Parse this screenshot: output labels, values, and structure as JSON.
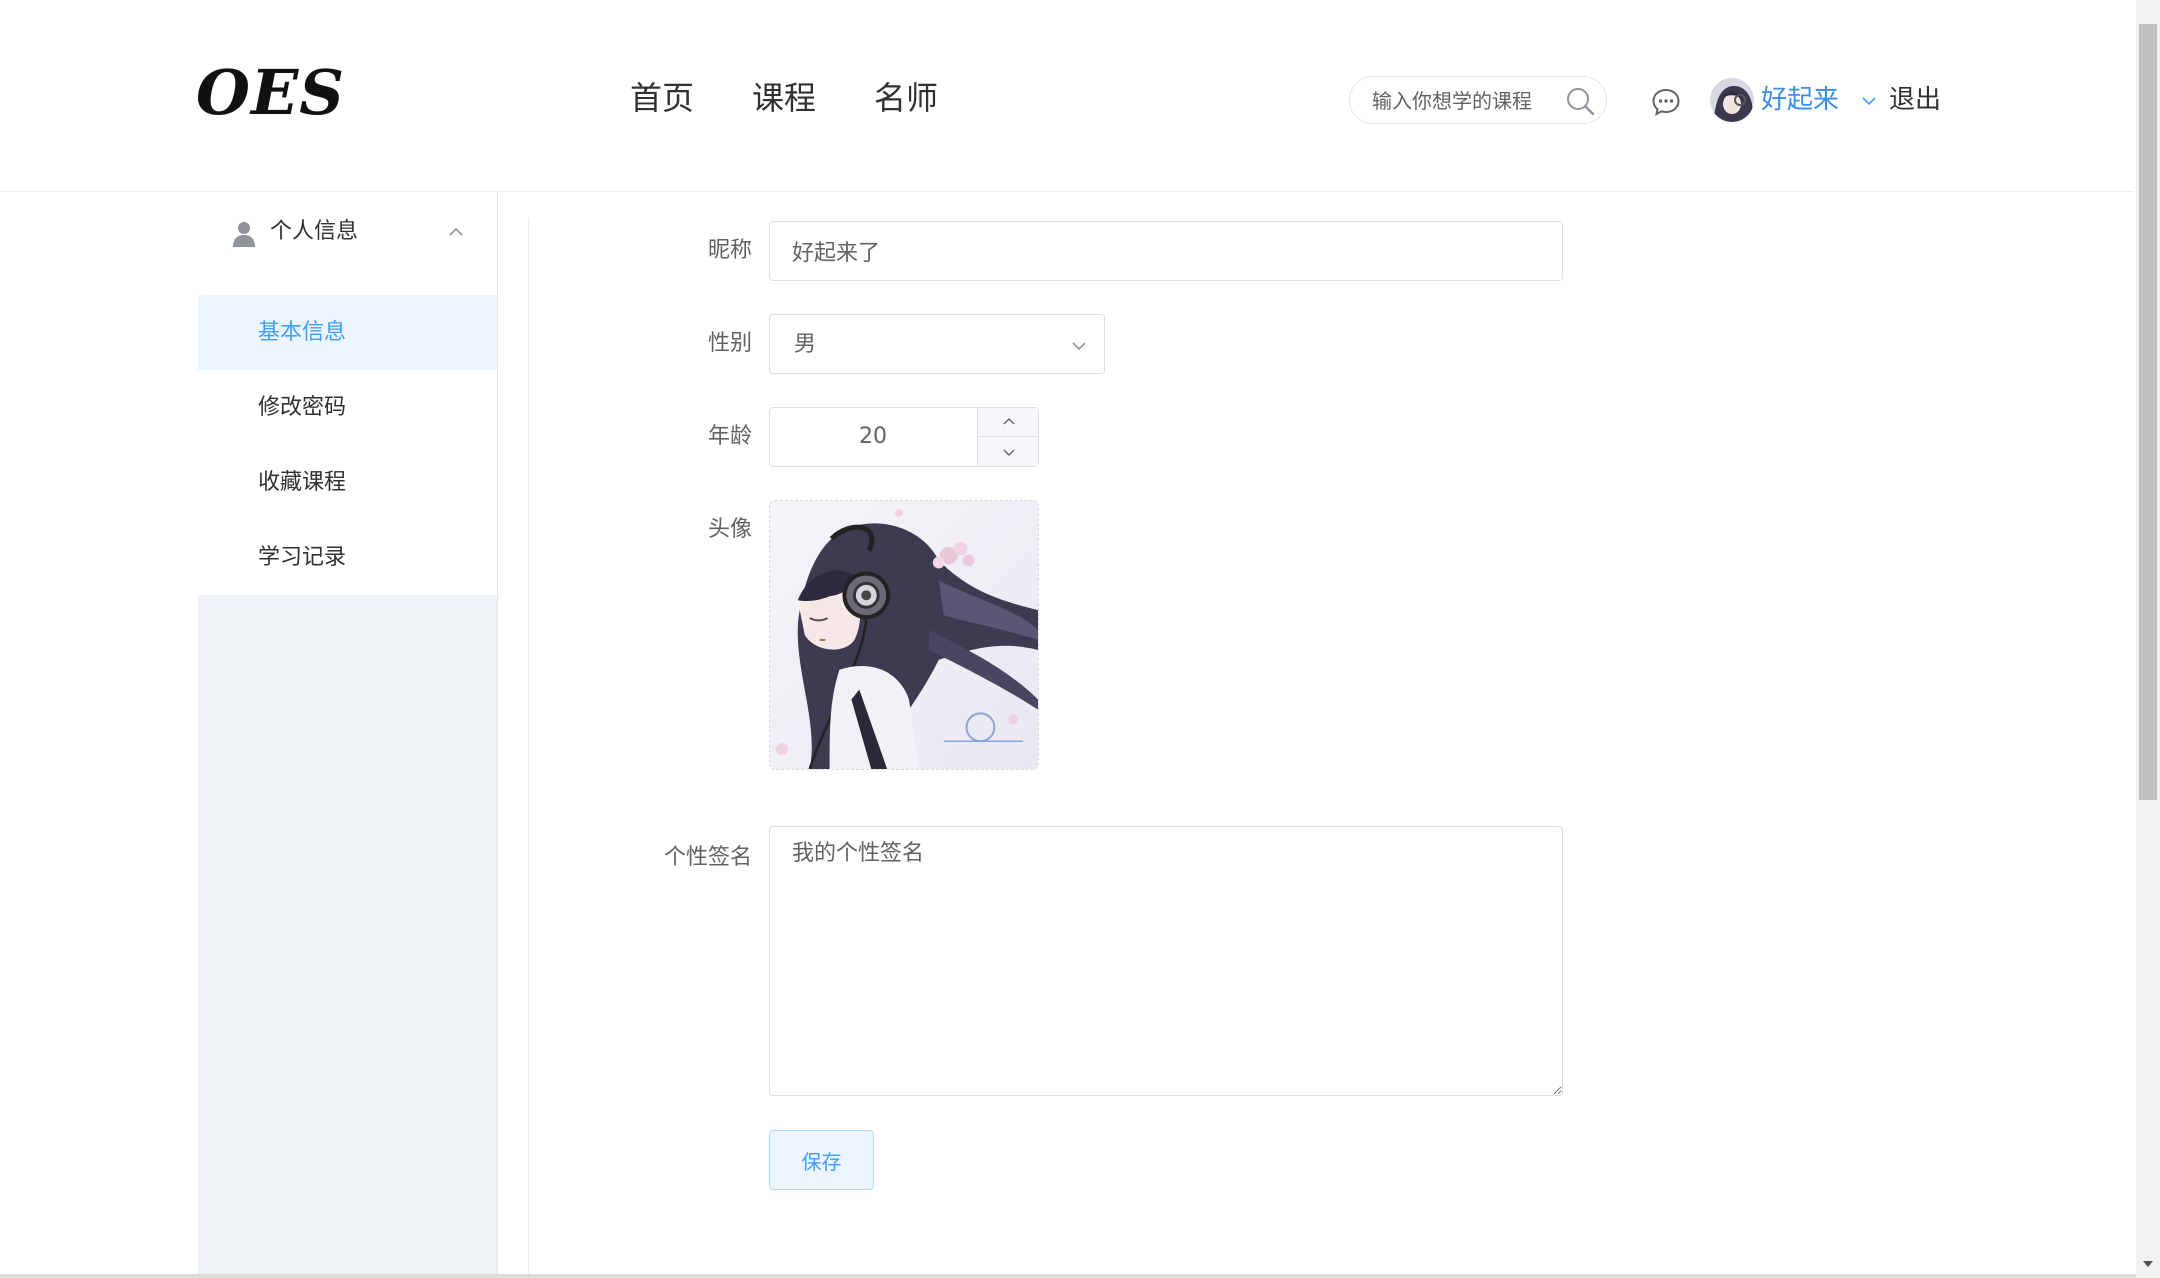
{
  "header": {
    "logo": "OES",
    "nav": [
      "首页",
      "课程",
      "名师"
    ],
    "search_placeholder": "输入你想学的课程",
    "username": "好起来",
    "logout": "退出"
  },
  "sidebar": {
    "group_label": "个人信息",
    "items": [
      {
        "label": "基本信息",
        "active": true
      },
      {
        "label": "修改密码",
        "active": false
      },
      {
        "label": "收藏课程",
        "active": false
      },
      {
        "label": "学习记录",
        "active": false
      }
    ]
  },
  "form": {
    "nickname_label": "昵称",
    "nickname_value": "好起来了",
    "gender_label": "性别",
    "gender_value": "男",
    "age_label": "年龄",
    "age_value": "20",
    "avatar_label": "头像",
    "signature_label": "个性签名",
    "signature_value": "我的个性签名",
    "save_label": "保存"
  },
  "colors": {
    "accent": "#409eff",
    "username": "#3a8ee6",
    "sidebar_bg": "#eef1f6",
    "active_item_bg": "#ecf5ff"
  }
}
